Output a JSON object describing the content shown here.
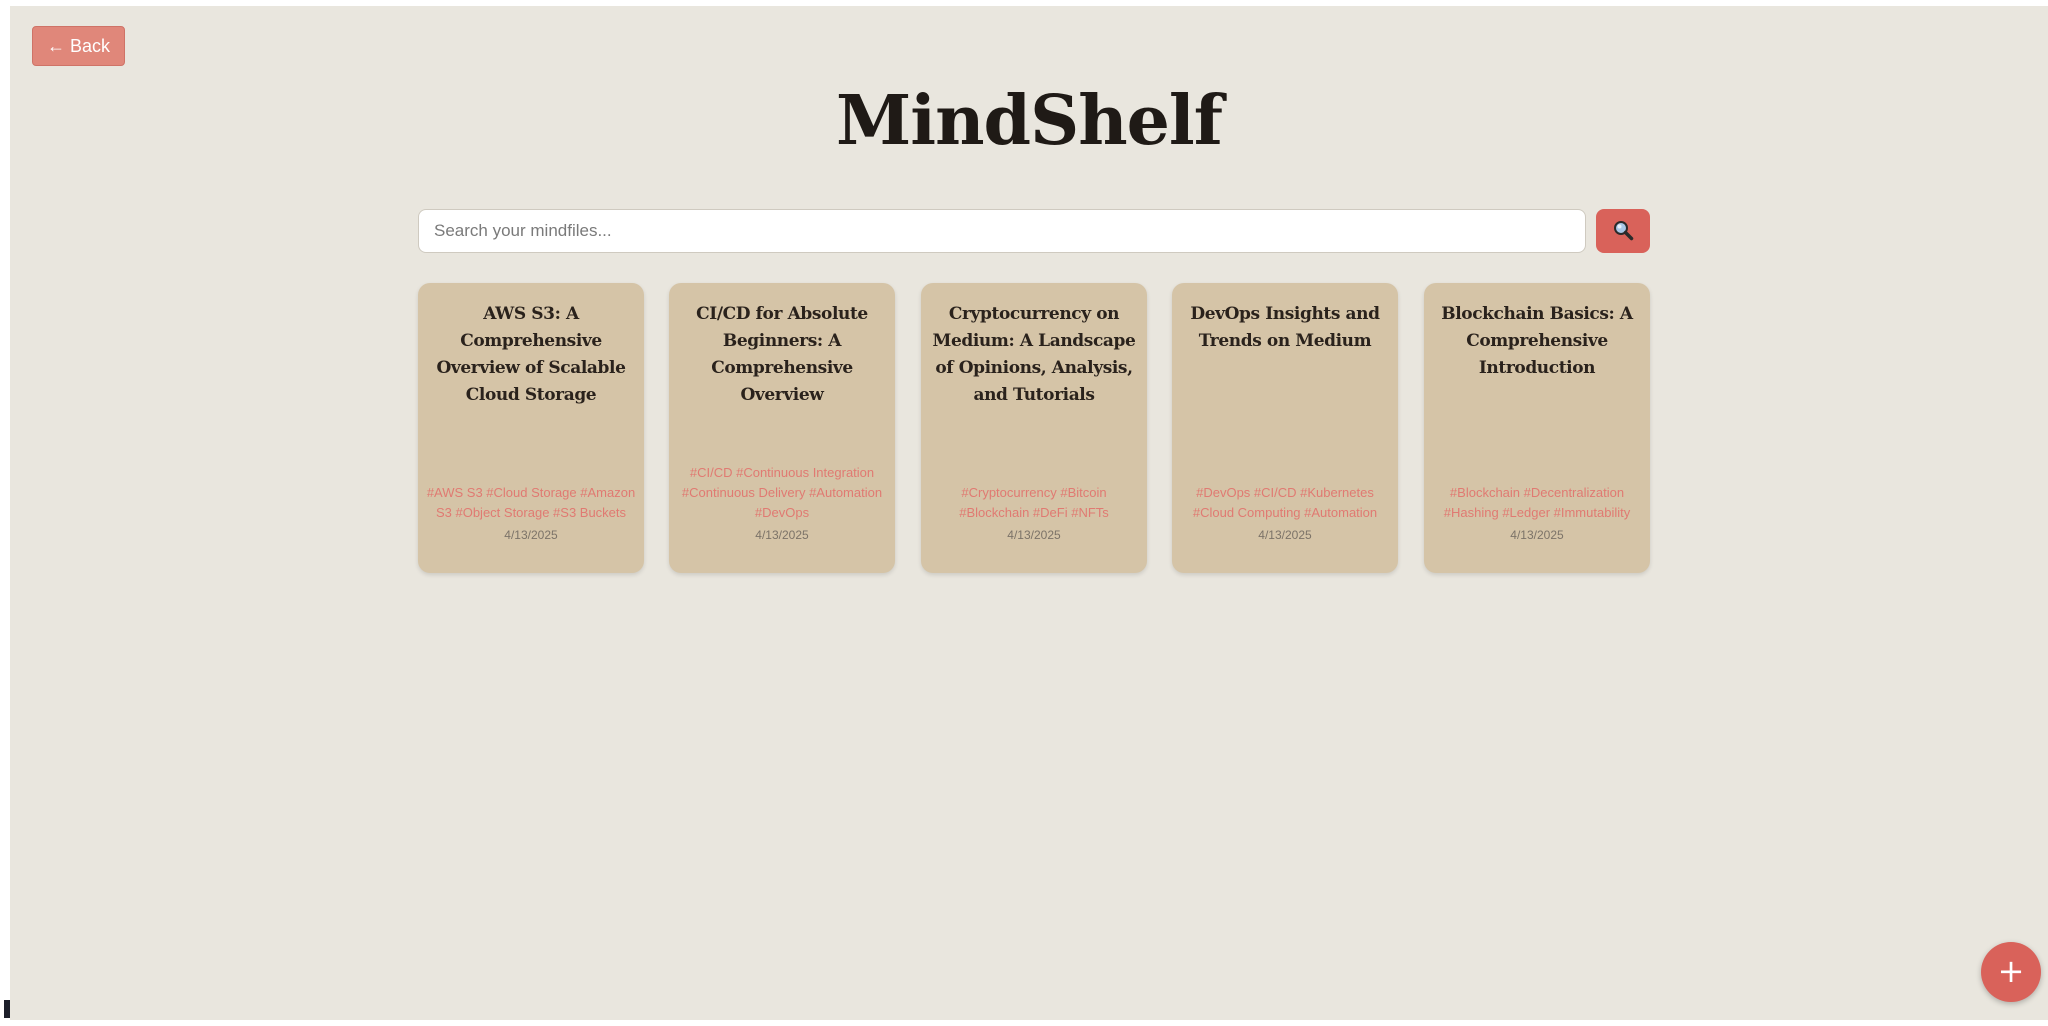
{
  "header": {
    "back_label": "← Back",
    "title": "MindShelf"
  },
  "search": {
    "placeholder": "Search your mindfiles...",
    "value": "",
    "button_icon": "magnifier-icon"
  },
  "cards": [
    {
      "title": "AWS S3: A Comprehensive Overview of Scalable Cloud Storage",
      "tags": "#AWS S3 #Cloud Storage #Amazon S3 #Object Storage #S3 Buckets",
      "date": "4/13/2025"
    },
    {
      "title": "CI/CD for Absolute Beginners: A Comprehensive Overview",
      "tags": "#CI/CD #Continuous Integration #Continuous Delivery #Automation #DevOps",
      "date": "4/13/2025"
    },
    {
      "title": "Cryptocurrency on Medium: A Landscape of Opinions, Analysis, and Tutorials",
      "tags": "#Cryptocurrency #Bitcoin #Blockchain #DeFi #NFTs",
      "date": "4/13/2025"
    },
    {
      "title": "DevOps Insights and Trends on Medium",
      "tags": "#DevOps #CI/CD #Kubernetes #Cloud Computing #Automation",
      "date": "4/13/2025"
    },
    {
      "title": "Blockchain Basics: A Comprehensive Introduction",
      "tags": "#Blockchain #Decentralization #Hashing #Ledger #Immutability",
      "date": "4/13/2025"
    }
  ],
  "fab": {
    "label": "+"
  },
  "colors": {
    "background": "#e9e6de",
    "card": "#d5c4a7",
    "accent": "#d9625a",
    "back_button": "#e0877a",
    "tag_text": "#e07a72"
  }
}
